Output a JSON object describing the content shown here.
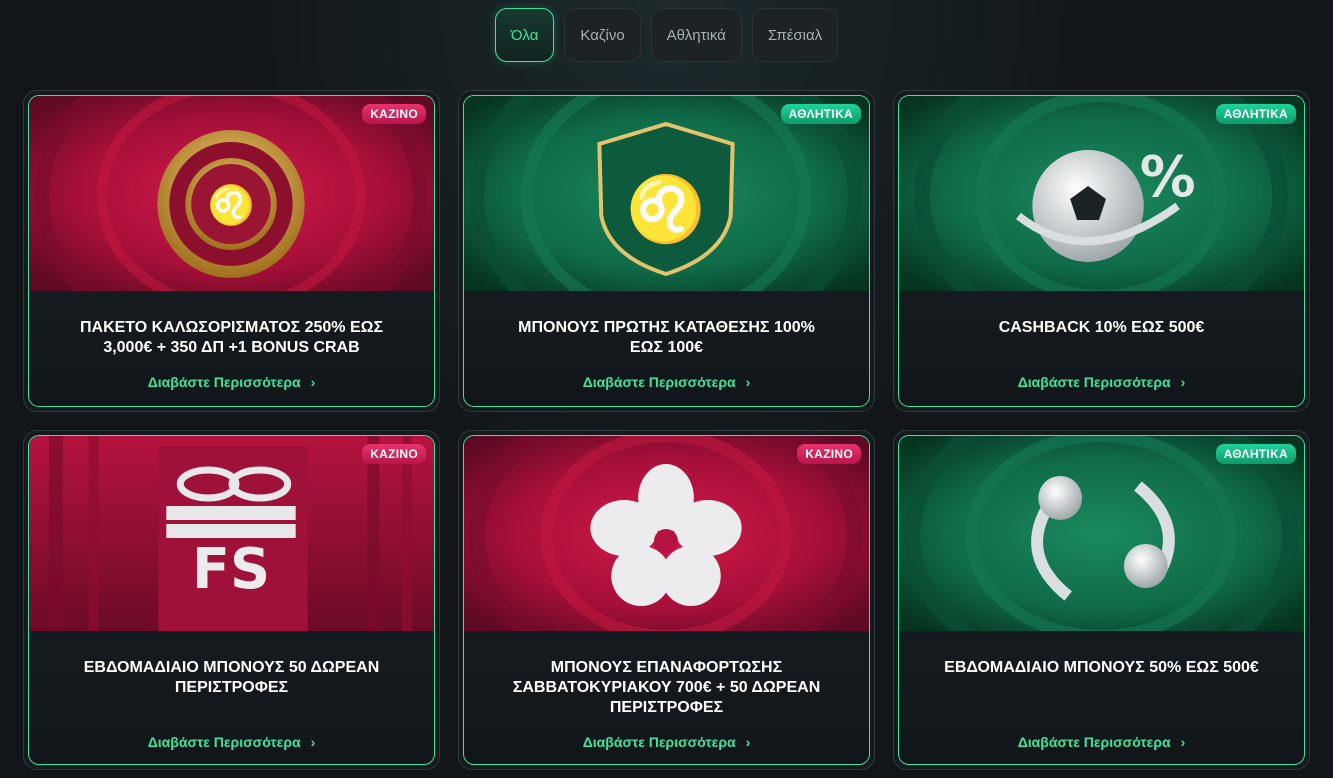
{
  "tabs": [
    {
      "label": "Όλα",
      "active": true
    },
    {
      "label": "Καζίνο",
      "active": false
    },
    {
      "label": "Αθλητικά",
      "active": false
    },
    {
      "label": "Σπέσιαλ",
      "active": false
    }
  ],
  "cards": [
    {
      "badge": "ΚΑΖΙΝΟ",
      "title": "ΠΑΚΕΤΟ ΚΑΛΩΣΟΡΙΣΜΑΤΟΣ 250% ΕΩΣ 3,000€ + 350 ΔΠ +1 BONUS CRAB",
      "link": "Διαβάστε Περισσότερα",
      "image_icon": "casino-chip-lion-icon"
    },
    {
      "badge": "ΑΘΛΗΤΙΚΑ",
      "title": "ΜΠΟΝΟΥΣ ΠΡΩΤΗΣ ΚΑΤΑΘΕΣΗΣ 100% ΕΩΣ 100€",
      "link": "Διαβάστε Περισσότερα",
      "image_icon": "lion-shield-icon"
    },
    {
      "badge": "ΑΘΛΗΤΙΚΑ",
      "title": "CASHBACK 10% ΕΩΣ 500€",
      "link": "Διαβάστε Περισσότερα",
      "image_icon": "football-percent-icon"
    },
    {
      "badge": "ΚΑΖΙΝΟ",
      "title": "ΕΒΔΟΜΑΔΙΑΙΟ ΜΠΟΝΟΥΣ 50 ΔΩΡΕΑΝ ΠΕΡΙΣΤΡΟΦΕΣ",
      "link": "Διαβάστε Περισσότερα",
      "image_icon": "gift-fs-icon",
      "image_text": "FS"
    },
    {
      "badge": "ΚΑΖΙΝΟ",
      "title": "ΜΠΟΝΟΥΣ ΕΠΑΝΑΦΟΡΤΩΣΗΣ ΣΑΒΒΑΤΟΚΥΡΙΑΚΟΥ 700€ + 50 ΔΩΡΕΑΝ ΠΕΡΙΣΤΡΟΦΕΣ",
      "link": "Διαβάστε Περισσότερα",
      "image_icon": "clover-flower-icon"
    },
    {
      "badge": "ΑΘΛΗΤΙΚΑ",
      "title": "ΕΒΔΟΜΑΔΙΑΙΟ ΜΠΟΝΟΥΣ 50% ΕΩΣ 500€",
      "link": "Διαβάστε Περισσότερα",
      "image_icon": "tennis-balls-swirl-icon"
    }
  ],
  "colors": {
    "accent": "#3fe39b",
    "casino_badge": "#d62260",
    "sport_badge": "#17c08a",
    "casino_bg": "#a3123d",
    "sport_bg": "#0f6a48"
  }
}
